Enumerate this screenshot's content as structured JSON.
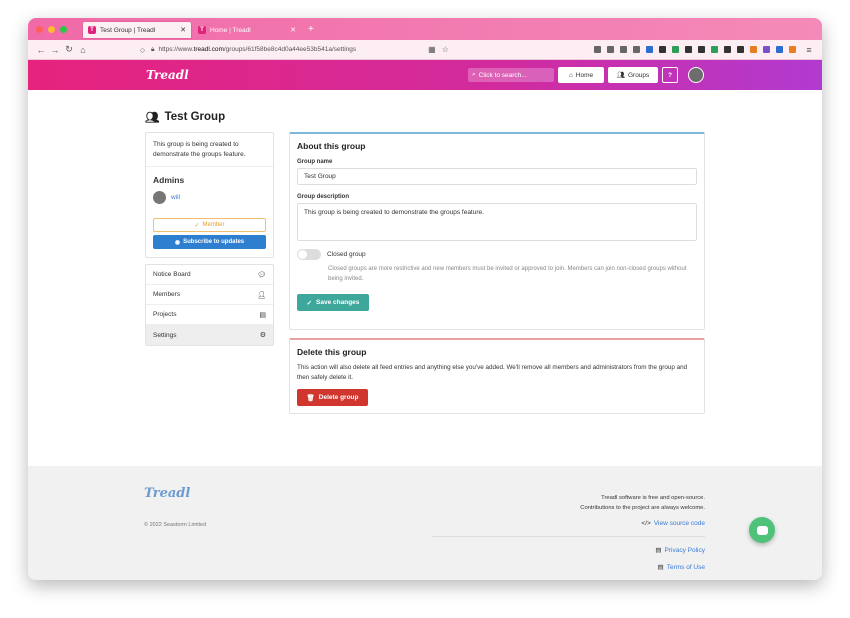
{
  "browser": {
    "tabs": [
      {
        "label": "Test Group | Treadl",
        "active": true
      },
      {
        "label": "Home | Treadl",
        "active": false
      }
    ],
    "new_tab": "+",
    "url_prefix": "https://www.",
    "url_host": "treadl.com",
    "url_path": "/groups/61f58be8c4d0a44ee53b541a/settings"
  },
  "header": {
    "logo": "Treadl",
    "search_placeholder": "Click to search...",
    "home_label": "Home",
    "groups_label": "Groups",
    "help_label": "?"
  },
  "page": {
    "title": "Test Group"
  },
  "sidebar": {
    "description": "This group is being created to demonstrate the groups feature.",
    "admins_title": "Admins",
    "admin_name": "will",
    "member_label": "Member",
    "subscribe_label": "Subscribe to updates",
    "menu": [
      {
        "label": "Notice Board",
        "icon": "comment-icon"
      },
      {
        "label": "Members",
        "icon": "user-icon"
      },
      {
        "label": "Projects",
        "icon": "book-icon"
      },
      {
        "label": "Settings",
        "icon": "gears-icon",
        "active": true
      }
    ]
  },
  "about": {
    "title": "About this group",
    "name_label": "Group name",
    "name_value": "Test Group",
    "desc_label": "Group description",
    "desc_value": "This group is being created to demonstrate the groups feature.",
    "closed_label": "Closed group",
    "closed_help": "Closed groups are more restrictive and new members must be invited or approved to join. Members can join non-closed groups without being invited.",
    "save_label": "Save changes"
  },
  "delete": {
    "title": "Delete this group",
    "text": "This action will also delete all feed entries and anything else you've added. We'll remove all members and administrators from the group and then safely delete it.",
    "button_label": "Delete group"
  },
  "footer": {
    "logo": "Treadl",
    "copyright": "© 2022 Seastorm Limited",
    "line1": "Treadl software is free and open-source.",
    "line2": "Contributions to the project are always welcome.",
    "source_link": "View source code",
    "privacy_link": "Privacy Policy",
    "terms_link": "Terms of Use"
  },
  "colors": {
    "header_start": "#e6237d",
    "header_end": "#b13ad0",
    "save_button": "#3ea79b",
    "delete_button": "#d0352e",
    "subscribe_button": "#2e7fd0",
    "link": "#3a7bd5",
    "chat_bubble": "#4fc27a"
  }
}
